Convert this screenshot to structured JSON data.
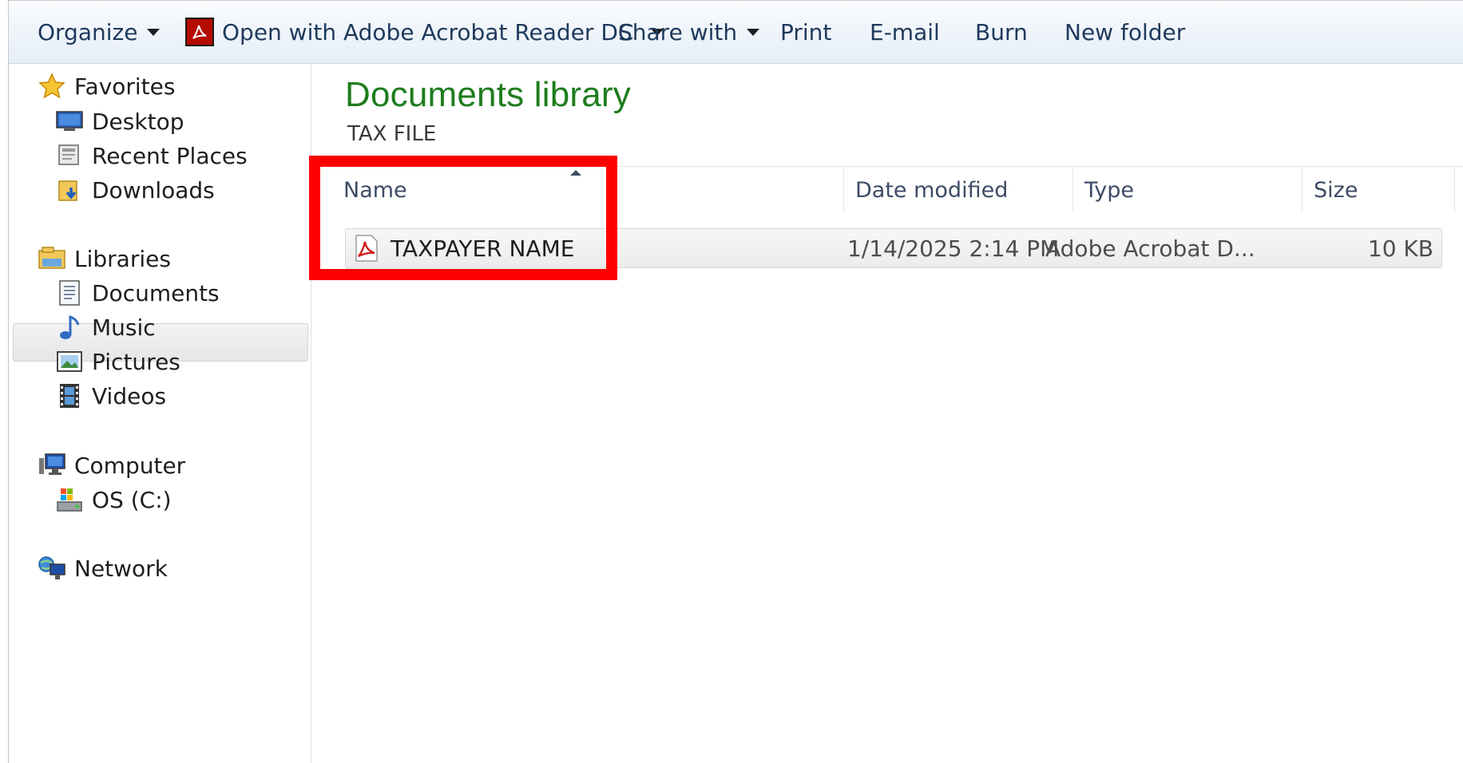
{
  "toolbar": {
    "organize": "Organize",
    "open_with": "Open with Adobe Acrobat Reader DC",
    "share_with": "Share with",
    "print": "Print",
    "email": "E-mail",
    "burn": "Burn",
    "new_folder": "New folder"
  },
  "nav": {
    "favorites": "Favorites",
    "desktop": "Desktop",
    "recent_places": "Recent Places",
    "downloads": "Downloads",
    "libraries": "Libraries",
    "documents": "Documents",
    "music": "Music",
    "pictures": "Pictures",
    "videos": "Videos",
    "computer": "Computer",
    "os_c": "OS (C:)",
    "network": "Network"
  },
  "library": {
    "title": "Documents library",
    "subtitle": "TAX FILE"
  },
  "columns": {
    "name": "Name",
    "date_modified": "Date modified",
    "type": "Type",
    "size": "Size"
  },
  "files": [
    {
      "name": "TAXPAYER NAME",
      "date_modified": "1/14/2025 2:14 PM",
      "type": "Adobe Acrobat D...",
      "size": "10 KB"
    }
  ],
  "colors": {
    "library_title": "#1e7d1e",
    "highlight": "#ff0000",
    "pdf_red": "#b30b00"
  }
}
